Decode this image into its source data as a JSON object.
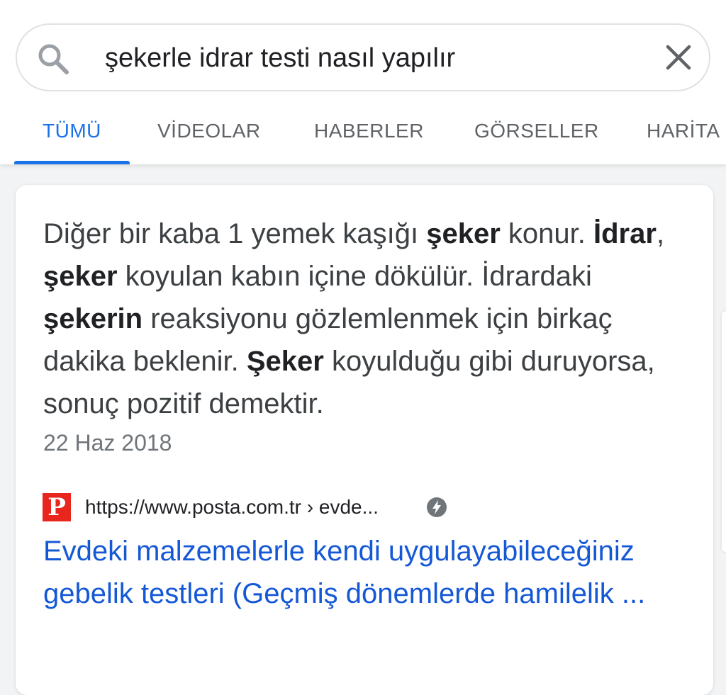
{
  "search": {
    "query": "şekerle idrar testi nasıl yapılır"
  },
  "icons": {
    "search": "search-icon",
    "clear": "close-icon",
    "amp": "amp-lightning-icon",
    "favicon": "posta-favicon-icon"
  },
  "tabs": [
    {
      "label": "TÜMÜ",
      "active": true
    },
    {
      "label": "VİDEOLAR",
      "active": false
    },
    {
      "label": "HABERLER",
      "active": false
    },
    {
      "label": "GÖRSELLER",
      "active": false
    },
    {
      "label": "HARİTA",
      "active": false
    }
  ],
  "featured_snippet": {
    "segments": [
      {
        "text": "Diğer bir kaba 1 yemek kaşığı ",
        "bold": false
      },
      {
        "text": "şeker",
        "bold": true
      },
      {
        "text": " konur. ",
        "bold": false
      },
      {
        "text": "İdrar",
        "bold": true
      },
      {
        "text": ", ",
        "bold": false
      },
      {
        "text": "şeker",
        "bold": true
      },
      {
        "text": " koyulan kabın içine dökülür. İdrardaki ",
        "bold": false
      },
      {
        "text": "şekerin",
        "bold": true
      },
      {
        "text": " reaksiyonu gözlemlenmek için birkaç dakika beklenir. ",
        "bold": false
      },
      {
        "text": "Şeker",
        "bold": true
      },
      {
        "text": " koyulduğu gibi duruyorsa, sonuç pozitif demektir.",
        "bold": false
      }
    ],
    "date": "22 Haz 2018"
  },
  "result": {
    "favicon_letter": "P",
    "url": "https://www.posta.com.tr › evde...",
    "title": "Evdeki malzemelerle kendi uygulayabileceğiniz gebelik testleri (Geçmiş dönemlerde hamilelik ..."
  },
  "colors": {
    "accent": "#1a73e8",
    "link": "#1558d6",
    "favicon_bg": "#e8261e",
    "text_primary": "#202124",
    "text_secondary": "#5f6368"
  }
}
